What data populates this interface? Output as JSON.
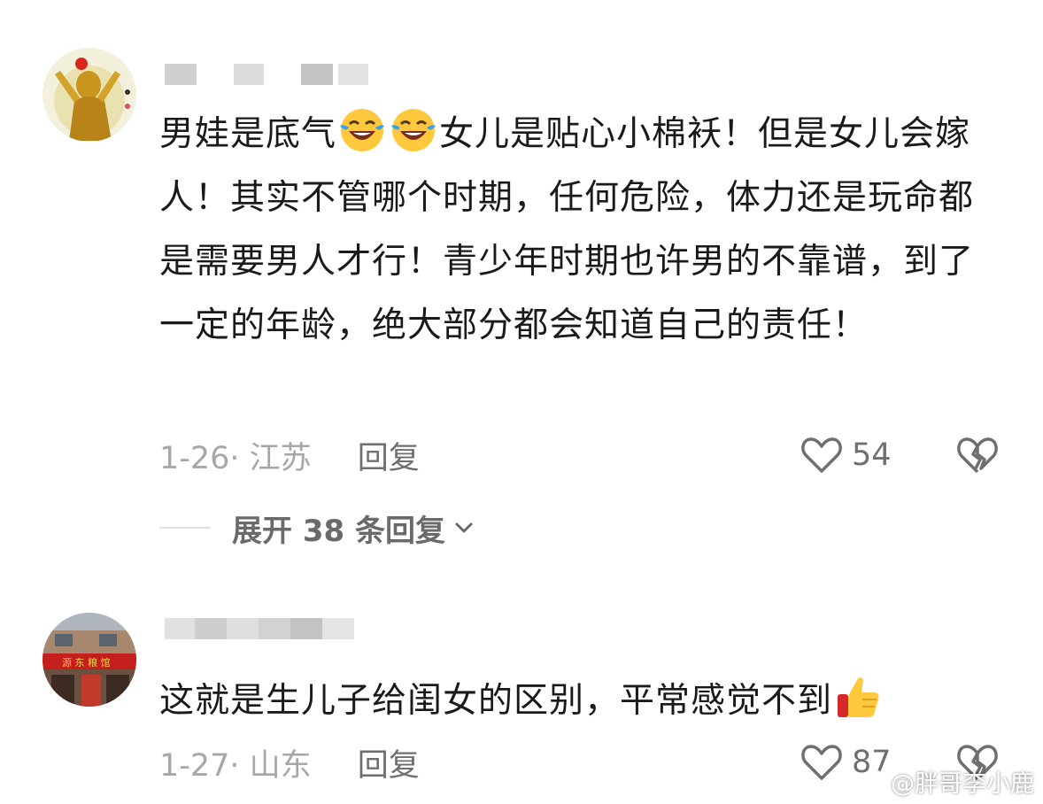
{
  "comments": [
    {
      "text_parts": [
        "男娃是底气",
        "女儿是贴心小棉袄！但是女儿会嫁人！其实不管哪个时期，任何危险，体力还是玩命都是需要男人才行！青少年时期也许男的不靠谱，到了一定的年龄，绝大部分都会知道自己的责任！"
      ],
      "emoji": [
        "laughing-crying-emoji",
        "laughing-crying-emoji"
      ],
      "date_location": "1-26· 江苏",
      "reply_label": "回复",
      "likes": "54"
    },
    {
      "text": "这就是生儿子给闺女的区别，平常感觉不到",
      "emoji": [
        "thumbs-up-emoji"
      ],
      "date_location": "1-27· 山东",
      "reply_label": "回复",
      "likes": "87"
    }
  ],
  "expand_replies_label": "展开 38 条回复",
  "watermark": "@胖哥李小鹿",
  "icons": {
    "like": "heart-outline-icon",
    "dislike": "broken-heart-icon",
    "expand": "chevron-down-icon",
    "watermark": "weibo-logo-icon"
  },
  "colors": {
    "text": "#1a1a1a",
    "meta": "#a7a7a7",
    "action": "#6f6f6f"
  }
}
